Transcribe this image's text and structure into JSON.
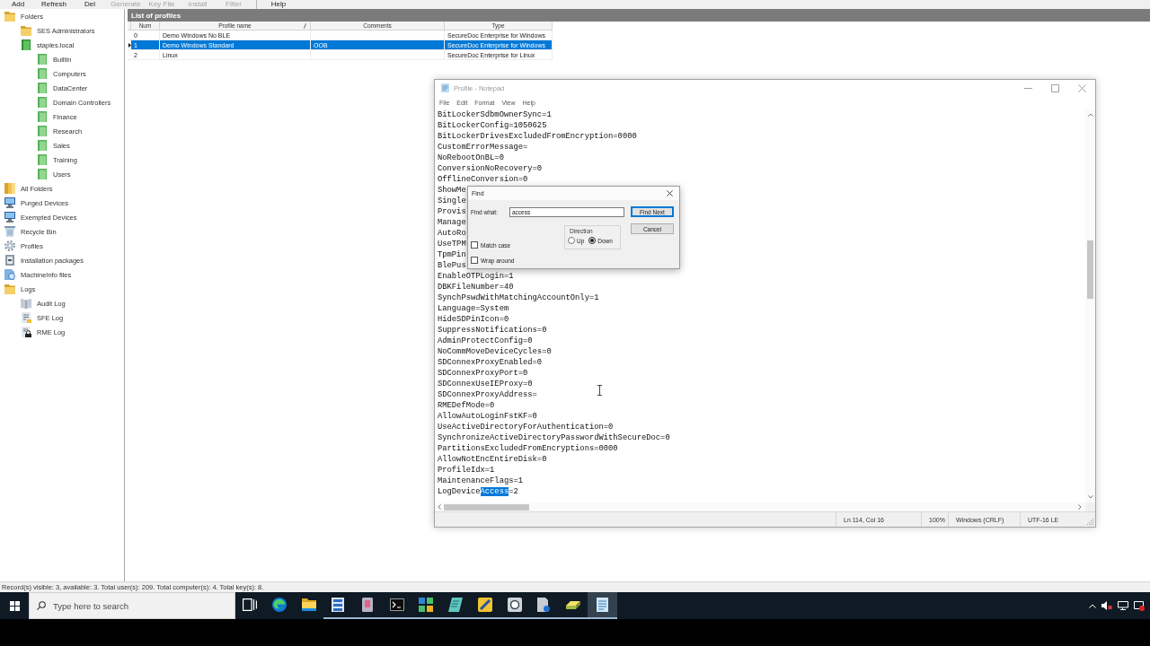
{
  "toolbar": {
    "groups": [
      [
        {
          "label": "Add",
          "disabled": false
        },
        {
          "label": "Refresh",
          "disabled": false
        },
        {
          "label": "Del",
          "disabled": false
        },
        {
          "label": "Generate",
          "disabled": true
        },
        {
          "label": "Key File",
          "disabled": true
        },
        {
          "label": "Install",
          "disabled": true
        },
        {
          "label": "Filter",
          "disabled": true
        }
      ],
      [
        {
          "label": "Help",
          "disabled": false
        }
      ]
    ]
  },
  "sidebar": {
    "items": [
      {
        "label": "Folders",
        "kind": "folder",
        "children": [
          {
            "label": "SES Administrators",
            "kind": "folder"
          },
          {
            "label": "staples.local",
            "kind": "domain",
            "children": [
              {
                "label": "Builtin",
                "kind": "unit"
              },
              {
                "label": "Computers",
                "kind": "unit"
              },
              {
                "label": "DataCenter",
                "kind": "unit"
              },
              {
                "label": "Domain Controllers",
                "kind": "unit"
              },
              {
                "label": "Finance",
                "kind": "unit"
              },
              {
                "label": "Research",
                "kind": "unit"
              },
              {
                "label": "Sales",
                "kind": "unit"
              },
              {
                "label": "Training",
                "kind": "unit"
              },
              {
                "label": "Users",
                "kind": "unit"
              }
            ]
          }
        ]
      },
      {
        "label": "All Folders",
        "kind": "group"
      },
      {
        "label": "Purged Devices",
        "kind": "devices"
      },
      {
        "label": "Exempted Devices",
        "kind": "devices"
      },
      {
        "label": "Recycle Bin",
        "kind": "bin"
      },
      {
        "label": "Profiles",
        "kind": "profiles"
      },
      {
        "label": "Installation packages",
        "kind": "packages"
      },
      {
        "label": "MachineInfo files",
        "kind": "files"
      },
      {
        "label": "Logs",
        "kind": "folder",
        "children": [
          {
            "label": "Audit Log",
            "kind": "journal"
          },
          {
            "label": "SFE Log",
            "kind": "listing"
          },
          {
            "label": "RME Log",
            "kind": "locked"
          }
        ]
      }
    ]
  },
  "profiles": {
    "title": "List of profiles",
    "columns": [
      {
        "label": "Num",
        "sorted": false
      },
      {
        "label": "Profile name",
        "sorted": true
      },
      {
        "label": "Comments",
        "sorted": false
      },
      {
        "label": "Type",
        "sorted": false
      }
    ],
    "rows": [
      {
        "num": "0",
        "name": "Demo Windows No BLE",
        "type": "SecureDoc Enterprise for Windows",
        "selected": false
      },
      {
        "num": "1",
        "name": "Demo Windows Standard",
        "comments": "OOB",
        "type": "SecureDoc Enterprise for Windows",
        "selected": true
      },
      {
        "num": "2",
        "name": "Linux",
        "type": "SecureDoc Enterprise for Linux",
        "selected": false
      }
    ]
  },
  "status_bar": "Record(s) visible: 3, available: 3. Total user(s): 209. Total computer(s): 4. Total key(s): 8.",
  "notepad": {
    "title": "Profile - Notepad",
    "active": false,
    "menu": [
      "File",
      "Edit",
      "Format",
      "View",
      "Help"
    ],
    "lines": [
      {
        "segments": [
          {
            "text": "BitLockerSdbmOwnerSync=1",
            "selected": false
          }
        ]
      },
      {
        "segments": [
          {
            "text": "BitLockerConfig=1050625",
            "selected": false
          }
        ]
      },
      {
        "segments": [
          {
            "text": "BitLockerDrivesExcludedFromEncryption=0000",
            "selected": false
          }
        ]
      },
      {
        "segments": [
          {
            "text": "CustomErrorMessage=",
            "selected": false
          }
        ]
      },
      {
        "segments": [
          {
            "text": "NoRebootOnBL=0",
            "selected": false
          }
        ]
      },
      {
        "segments": [
          {
            "text": "ConversionNoRecovery=0",
            "selected": false
          }
        ]
      },
      {
        "segments": [
          {
            "text": "OfflineConversion=0",
            "selected": false
          }
        ]
      },
      {
        "segments": [
          {
            "text": "ShowMe",
            "selected": false
          }
        ]
      },
      {
        "segments": [
          {
            "text": "Single",
            "selected": false
          }
        ]
      },
      {
        "segments": [
          {
            "text": "Provis",
            "selected": false
          }
        ]
      },
      {
        "segments": [
          {
            "text": "Manage",
            "selected": false
          }
        ]
      },
      {
        "segments": [
          {
            "text": "AutoRo",
            "selected": false
          }
        ]
      },
      {
        "segments": [
          {
            "text": "UseTPM",
            "selected": false
          }
        ]
      },
      {
        "segments": [
          {
            "text": "TpmPin",
            "selected": false
          }
        ]
      },
      {
        "segments": [
          {
            "text": "BlePus",
            "selected": false
          }
        ]
      },
      {
        "segments": [
          {
            "text": "EnableOTPLogin=1",
            "selected": false
          }
        ]
      },
      {
        "segments": [
          {
            "text": "DBKFileNumber=40",
            "selected": false
          }
        ]
      },
      {
        "segments": [
          {
            "text": "SynchPswdWithMatchingAccountOnly=1",
            "selected": false
          }
        ]
      },
      {
        "segments": [
          {
            "text": "Language=System",
            "selected": false
          }
        ]
      },
      {
        "segments": [
          {
            "text": "HideSDPinIcon=0",
            "selected": false
          }
        ]
      },
      {
        "segments": [
          {
            "text": "SuppressNotifications=0",
            "selected": false
          }
        ]
      },
      {
        "segments": [
          {
            "text": "AdminProtectConfig=0",
            "selected": false
          }
        ]
      },
      {
        "segments": [
          {
            "text": "NoCommMoveDeviceCycles=0",
            "selected": false
          }
        ]
      },
      {
        "segments": [
          {
            "text": "SDConnexProxyEnabled=0",
            "selected": false
          }
        ]
      },
      {
        "segments": [
          {
            "text": "SDConnexProxyPort=0",
            "selected": false
          }
        ]
      },
      {
        "segments": [
          {
            "text": "SDConnexUseIEProxy=0",
            "selected": false
          }
        ]
      },
      {
        "segments": [
          {
            "text": "SDConnexProxyAddress=",
            "selected": false
          }
        ]
      },
      {
        "segments": [
          {
            "text": "RMEDefMode=0",
            "selected": false
          }
        ]
      },
      {
        "segments": [
          {
            "text": "AllowAutoLoginFstKF=0",
            "selected": false
          }
        ]
      },
      {
        "segments": [
          {
            "text": "UseActiveDirectoryForAuthentication=0",
            "selected": false
          }
        ]
      },
      {
        "segments": [
          {
            "text": "SynchronizeActiveDirectoryPasswordWithSecureDoc=0",
            "selected": false
          }
        ]
      },
      {
        "segments": [
          {
            "text": "PartitionsExcludedFromEncryptions=0000",
            "selected": false
          }
        ]
      },
      {
        "segments": [
          {
            "text": "AllowNotEncEntireDisk=0",
            "selected": false
          }
        ]
      },
      {
        "segments": [
          {
            "text": "ProfileIdx=1",
            "selected": false
          }
        ]
      },
      {
        "segments": [
          {
            "text": "MaintenanceFlags=1",
            "selected": false
          }
        ]
      },
      {
        "segments": [
          {
            "text": "LogDevice",
            "selected": false
          },
          {
            "text": "Access",
            "selected": true
          },
          {
            "text": "=2",
            "selected": false
          }
        ]
      }
    ],
    "status": [
      "Ln 114, Col 16",
      "100%",
      "Windows (CRLF)",
      "UTF-16 LE"
    ]
  },
  "find_dialog": {
    "title": "Find",
    "find_what_label": "Find what:",
    "find_what_value": "access",
    "buttons": [
      {
        "label": "Find Next",
        "default": true
      },
      {
        "label": "Cancel",
        "default": false
      }
    ],
    "direction": {
      "label": "Direction",
      "options": [
        {
          "label": "Up",
          "selected": false
        },
        {
          "label": "Down",
          "selected": true
        }
      ]
    },
    "options": [
      {
        "label": "Match case",
        "checked": false
      },
      {
        "label": "Wrap around",
        "checked": false
      }
    ]
  },
  "taskbar": {
    "search": {
      "placeholder": "Type here to search"
    },
    "apps": [
      {
        "kind": "taskview",
        "running": false,
        "selected": false
      },
      {
        "kind": "browser",
        "running": false,
        "selected": false
      },
      {
        "kind": "explorer",
        "running": false,
        "selected": false
      },
      {
        "kind": "server",
        "running": true,
        "selected": false
      },
      {
        "kind": "installer",
        "running": true,
        "selected": false
      },
      {
        "kind": "terminal",
        "running": true,
        "selected": false
      },
      {
        "kind": "network",
        "running": true,
        "selected": false
      },
      {
        "kind": "notes",
        "running": true,
        "selected": false
      },
      {
        "kind": "wizard",
        "running": true,
        "selected": false
      },
      {
        "kind": "camera",
        "running": true,
        "selected": false
      },
      {
        "kind": "document",
        "running": true,
        "selected": false
      },
      {
        "kind": "drive",
        "running": true,
        "selected": false
      },
      {
        "kind": "notepad",
        "running": true,
        "selected": true
      }
    ]
  }
}
